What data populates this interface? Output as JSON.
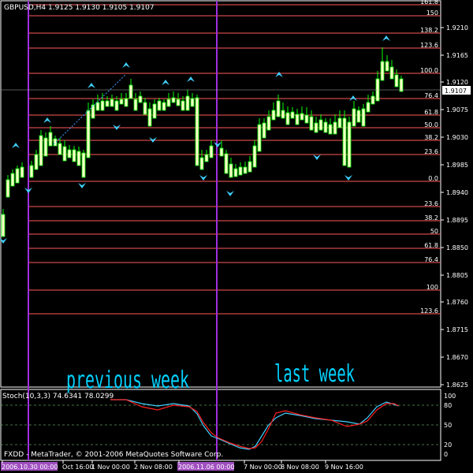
{
  "window": {
    "symbol_header": "GBPUSD,H4  1.9125 1.9130 1.9105 1.9107",
    "footer": "FXDD - MetaTrader, © 2001-2006 MetaQuotes Software Corp."
  },
  "labels": {
    "previous_week": "previous week",
    "last_week": "last week"
  },
  "price_axis": {
    "ticks": [
      "1.9210",
      "1.9165",
      "1.9120",
      "1.9075",
      "1.9030",
      "1.8985",
      "1.8940",
      "1.8895",
      "1.8850",
      "1.8805",
      "1.8760",
      "1.8715",
      "1.8670",
      "1.8625"
    ],
    "current": "1.9107"
  },
  "fib_upper": [
    "161.8",
    "150",
    "138.2",
    "123.6",
    "100.0",
    "76.4",
    "61.8",
    "50.0",
    "38.2",
    "23.6",
    "0.0"
  ],
  "fib_lower": [
    "23.6",
    "38.2",
    "50",
    "61.8",
    "76.4",
    "100",
    "123.6"
  ],
  "time_axis": [
    "2006.10.30 00:00",
    "Oct 16:00",
    "1 Nov 00:00",
    "2 Nov 08:00",
    "2006.11.06 00:00",
    "7 Nov 00:00",
    "8 Nov 08:00",
    "9 Nov 16:00"
  ],
  "stoch": {
    "label": "Stoch(10,3,3) 74.6341 78.0299",
    "ticks": [
      "100",
      "80",
      "50",
      "20",
      "0"
    ]
  },
  "colors": {
    "background": "#000000",
    "fib_line": "#ff5a5a",
    "vertical_line": "#a030e0",
    "candle_bull": "#ffffc8",
    "candle_bear": "#000000",
    "candle_border": "#00ff00",
    "fractal": "#40d0ff",
    "stoch_main": "#40d0ff",
    "stoch_signal": "#ff2020",
    "week_label": "#00d2ff",
    "highlight_bg": "#a050c0"
  },
  "icons": {
    "fractal_up": "up-arrow-icon",
    "fractal_down": "down-arrow-icon"
  }
}
